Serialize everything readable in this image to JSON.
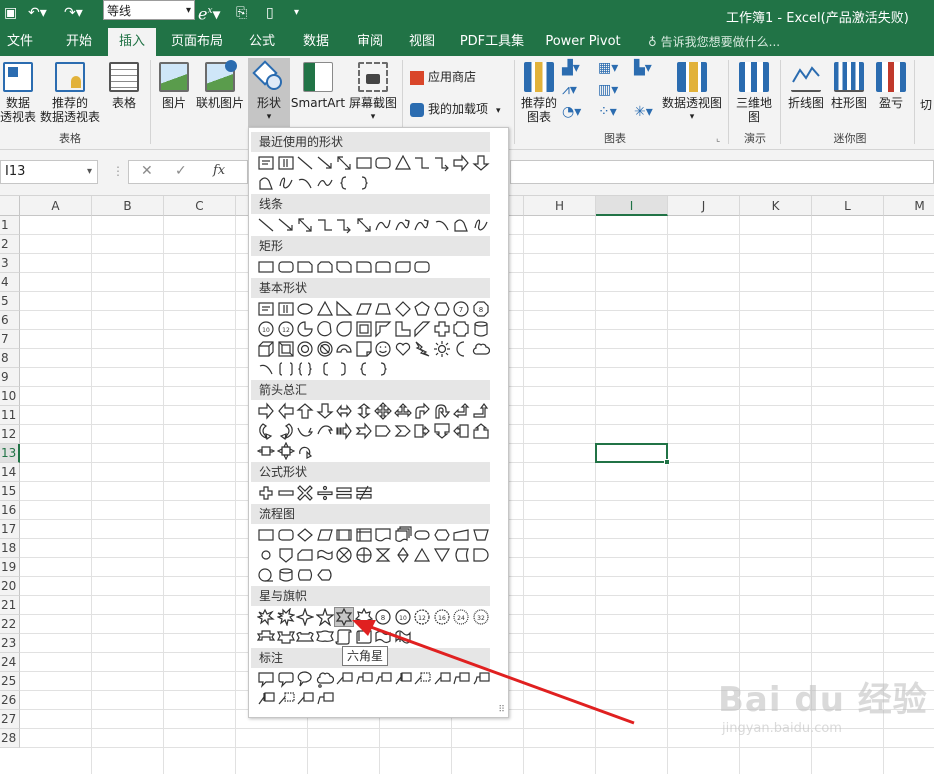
{
  "titlebar": {
    "font_name": "等线",
    "title": "工作簿1 - Excel(产品激活失败)",
    "icons": [
      "save-icon",
      "undo-icon",
      "redo-icon",
      "font-dropdown",
      "equation-icon",
      "copy-icon",
      "phone-icon",
      "more-icon"
    ]
  },
  "tabs": [
    {
      "label": "文件",
      "active": false
    },
    {
      "label": "开始",
      "active": false
    },
    {
      "label": "插入",
      "active": true
    },
    {
      "label": "页面布局",
      "active": false
    },
    {
      "label": "公式",
      "active": false
    },
    {
      "label": "数据",
      "active": false
    },
    {
      "label": "审阅",
      "active": false
    },
    {
      "label": "视图",
      "active": false
    },
    {
      "label": "PDF工具集",
      "active": false
    },
    {
      "label": "Power Pivot",
      "active": false
    }
  ],
  "tellme": "告诉我您想要做什么...",
  "ribbon": {
    "pivot_line1": "数据",
    "pivot_line2": "透视表",
    "rec_pivot_line1": "推荐的",
    "rec_pivot_line2": "数据透视表",
    "table": "表格",
    "group_tables": "表格",
    "picture": "图片",
    "online_picture": "联机图片",
    "shapes": "形状",
    "smartart": "SmartArt",
    "screenshot": "屏幕截图",
    "app_store": "应用商店",
    "my_addins": "我的加载项",
    "rec_charts_line1": "推荐的",
    "rec_charts_line2": "图表",
    "pivot_chart": "数据透视图",
    "group_charts": "图表",
    "map3d_line1": "三维地",
    "map3d_line2": "图",
    "group_demo": "演示",
    "line_spark": "折线图",
    "column_spark": "柱形图",
    "winloss_spark": "盈亏",
    "group_sparklines": "迷你图",
    "slicer_partial": "切"
  },
  "namebox": "I13",
  "columns": [
    "A",
    "B",
    "C",
    "D",
    "E",
    "F",
    "G",
    "H",
    "I",
    "J",
    "K",
    "L",
    "M"
  ],
  "rows": [
    "1",
    "2",
    "3",
    "4",
    "5",
    "6",
    "7",
    "8",
    "9",
    "10",
    "11",
    "12",
    "13",
    "14",
    "15",
    "16",
    "17",
    "18",
    "19",
    "20",
    "21",
    "22",
    "23",
    "24",
    "25",
    "26",
    "27",
    "28"
  ],
  "active_cell": "I13",
  "shapes_panel": {
    "sections": [
      "最近使用的形状",
      "线条",
      "矩形",
      "基本形状",
      "箭头总汇",
      "公式形状",
      "流程图",
      "星与旗帜",
      "标注"
    ],
    "tooltip": "六角星",
    "hovered_shape": "六角星"
  },
  "watermark": {
    "brand": "Bai du 经验",
    "url": "jingyan.baidu.com"
  },
  "colors": {
    "excel_green": "#217346",
    "ribbon_bg": "#f3f3f3",
    "hover": "#c5c5c5",
    "arrow": "#e02020"
  }
}
